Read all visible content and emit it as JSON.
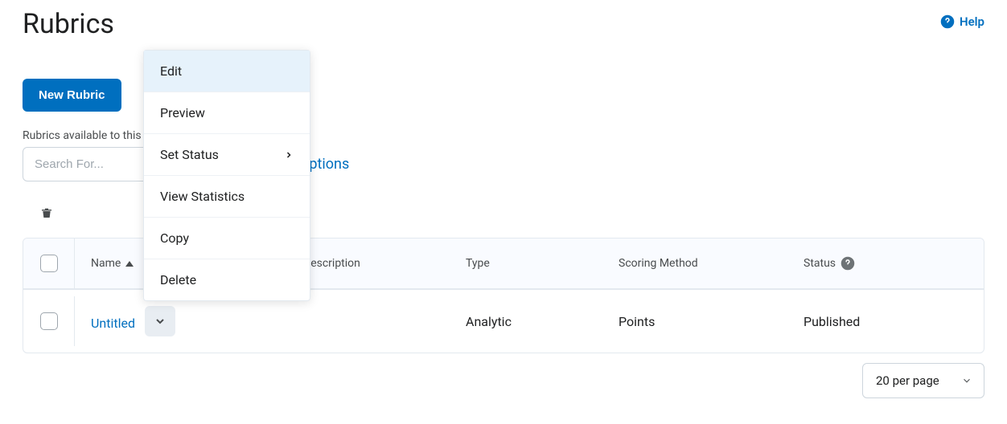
{
  "page": {
    "title": "Rubrics"
  },
  "help": {
    "label": "Help"
  },
  "toolbar": {
    "new_rubric_label": "New Rubric"
  },
  "availability_text": "Rubrics available to this",
  "search": {
    "placeholder": "Search For..."
  },
  "show_options_label": "Options",
  "table": {
    "headers": {
      "name": "Name",
      "description": "Description",
      "type": "Type",
      "scoring_method": "Scoring Method",
      "status": "Status"
    },
    "rows": [
      {
        "name": "Untitled",
        "description": "",
        "type": "Analytic",
        "scoring_method": "Points",
        "status": "Published"
      }
    ]
  },
  "pagination": {
    "per_page_label": "20 per page"
  },
  "dropdown": {
    "items": [
      {
        "label": "Edit",
        "highlighted": true,
        "has_submenu": false
      },
      {
        "label": "Preview",
        "highlighted": false,
        "has_submenu": false
      },
      {
        "label": "Set Status",
        "highlighted": false,
        "has_submenu": true
      },
      {
        "label": "View Statistics",
        "highlighted": false,
        "has_submenu": false
      },
      {
        "label": "Copy",
        "highlighted": false,
        "has_submenu": false
      },
      {
        "label": "Delete",
        "highlighted": false,
        "has_submenu": false
      }
    ]
  }
}
